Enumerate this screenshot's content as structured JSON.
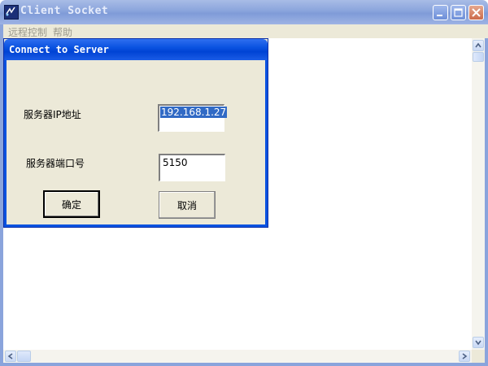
{
  "window": {
    "title": "Client Socket",
    "icon": "app-icon",
    "controls": [
      "minimize-icon",
      "maximize-icon",
      "close-icon"
    ]
  },
  "menu": {
    "items": [
      {
        "label": "远程控制"
      },
      {
        "label": "帮助"
      }
    ]
  },
  "dialog": {
    "title": "Connect to Server",
    "ip_label": "服务器IP地址",
    "ip_value": "192.168.1.27",
    "port_label": "服务器端口号",
    "port_value": "5150",
    "ok_label": "确定",
    "cancel_label": "取消"
  },
  "colors": {
    "dialog_title": "#0a52e0",
    "selection": "#316ac5",
    "window_title_inactive": "#8aa4dc"
  }
}
